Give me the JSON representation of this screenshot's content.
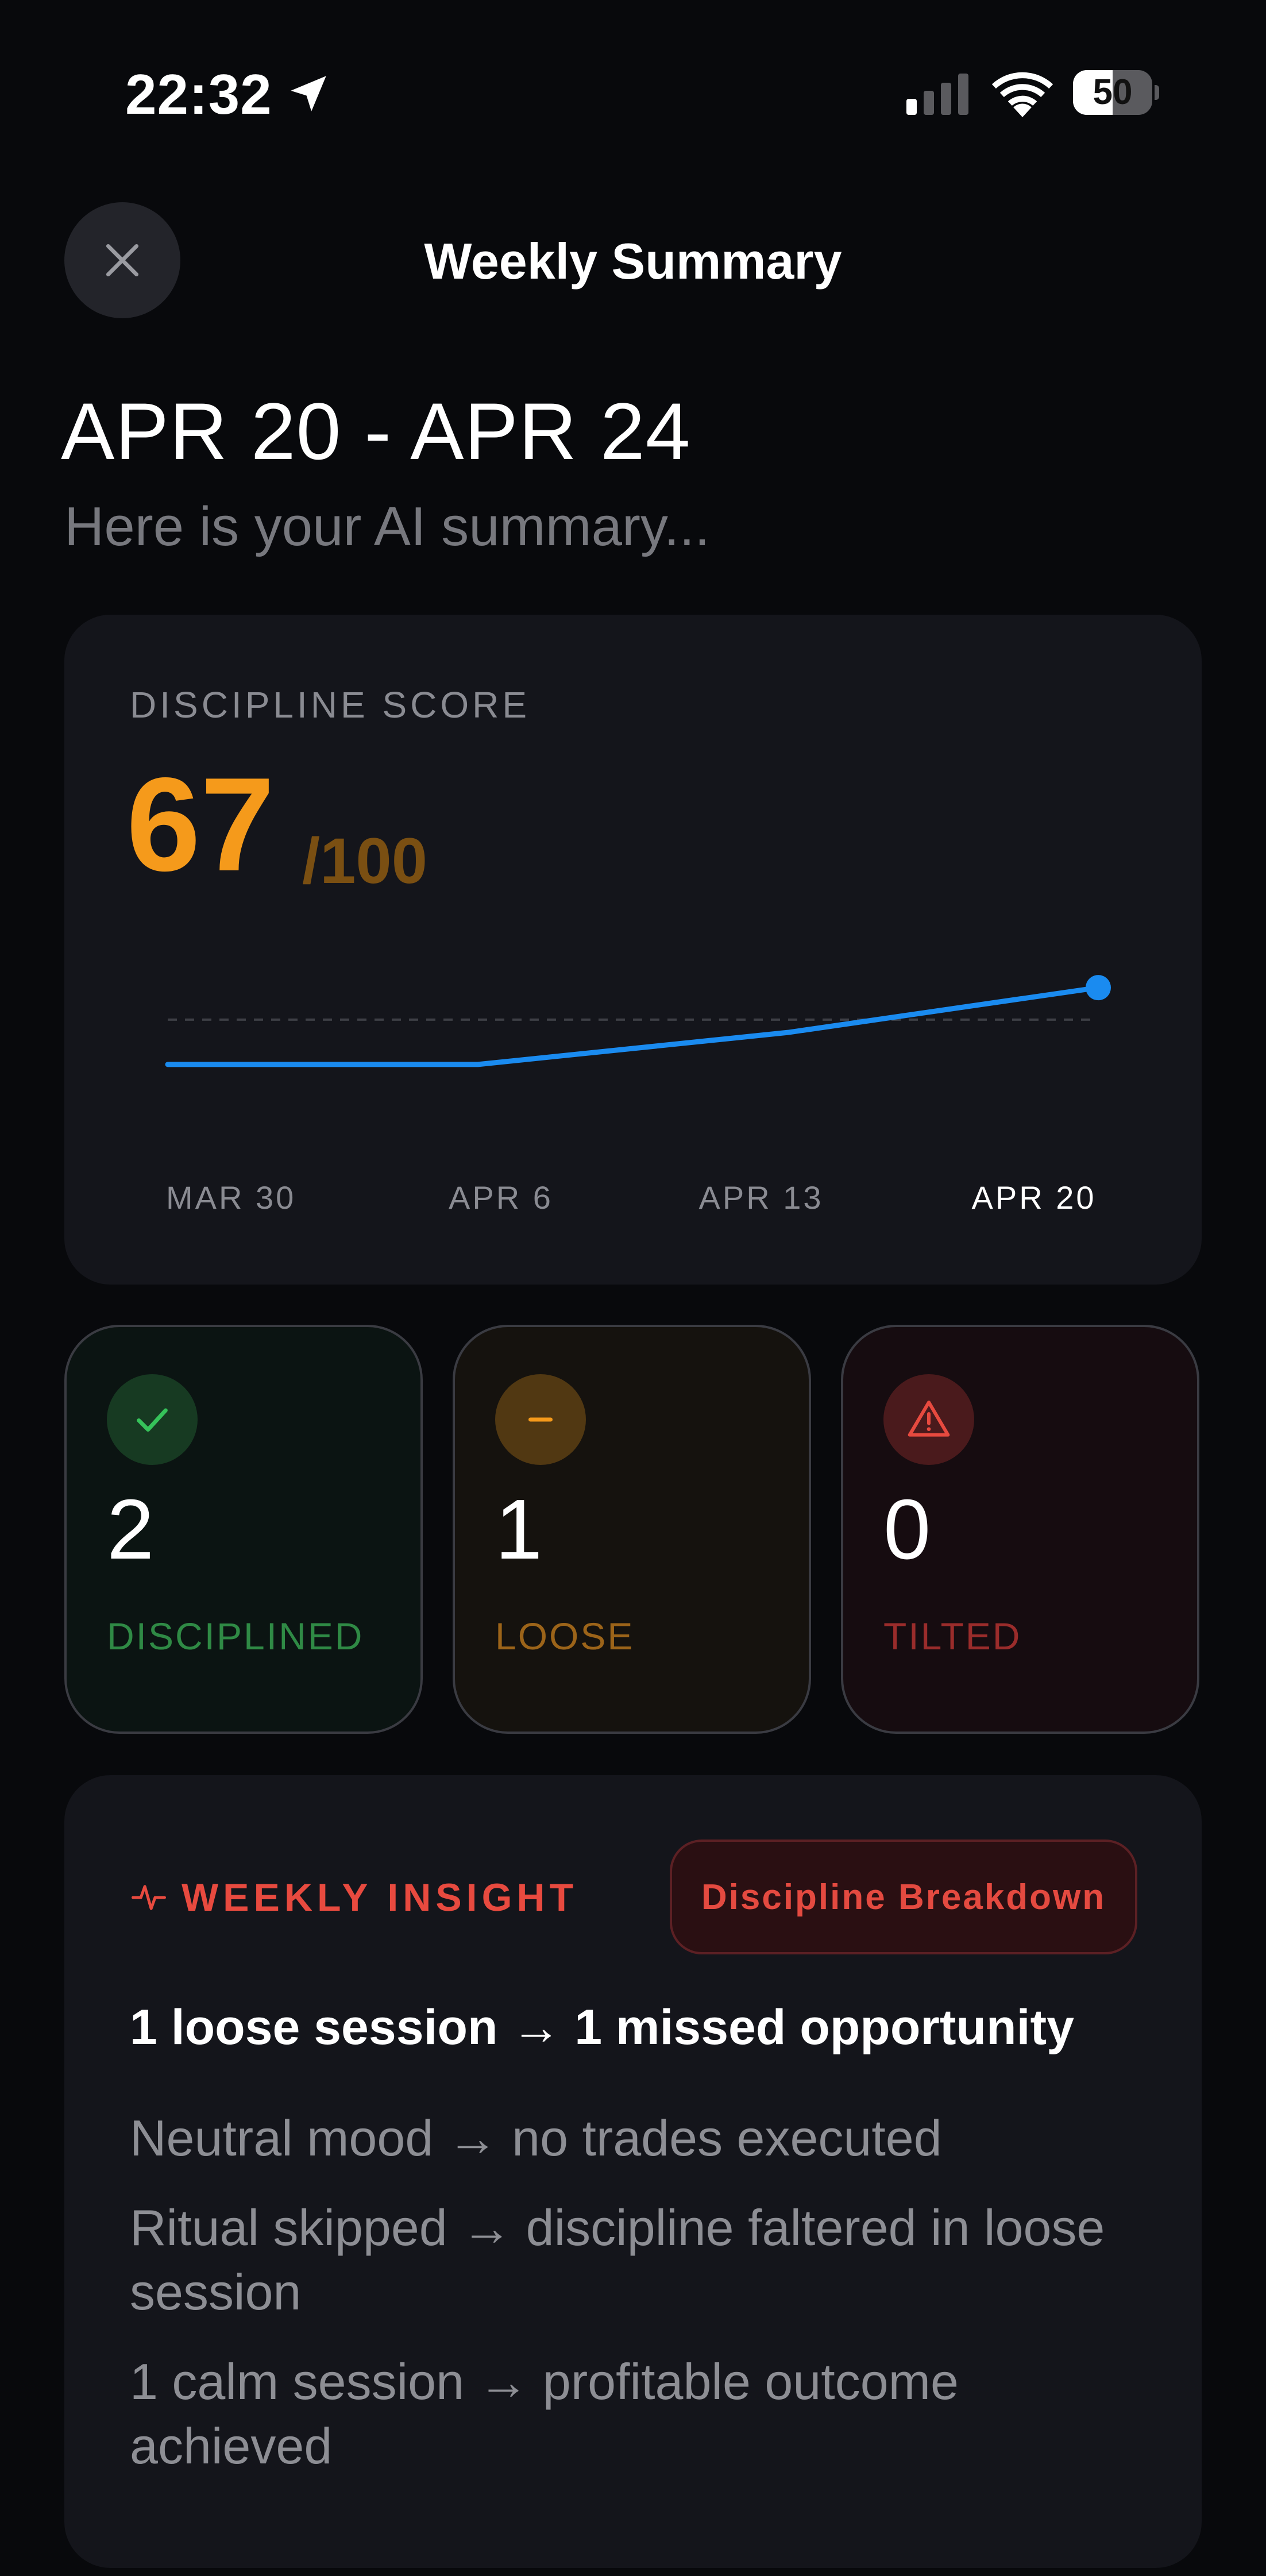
{
  "status_bar": {
    "time": "22:32",
    "battery_level": "50",
    "battery_fraction": 0.5,
    "icons": [
      "location-arrow-icon",
      "signal-icon",
      "wifi-icon",
      "battery-icon"
    ]
  },
  "header": {
    "title": "Weekly Summary",
    "close_icon": "close-icon"
  },
  "summary": {
    "date_range": "APR 20 - APR 24",
    "subtitle": "Here is your AI summary..."
  },
  "discipline": {
    "label": "DISCIPLINE SCORE",
    "score": "67",
    "max": "/100",
    "score_color": "#f59a1b"
  },
  "chart_data": {
    "type": "line",
    "categories": [
      "MAR 30",
      "APR 6",
      "APR 13",
      "APR 20"
    ],
    "series": [
      {
        "values": [
          55,
          55,
          60,
          67
        ]
      }
    ],
    "reference_line": 62,
    "active_category": "APR 20",
    "ylim": [
      40,
      75
    ],
    "line_color": "#1a8bf0",
    "grid": false
  },
  "stats": [
    {
      "count": "2",
      "label": "DISCIPLINED",
      "icon": "check-icon",
      "color": "#2f8a45"
    },
    {
      "count": "1",
      "label": "LOOSE",
      "icon": "minus-icon",
      "color": "#9c6419"
    },
    {
      "count": "0",
      "label": "TILTED",
      "icon": "warning-icon",
      "color": "#9a2c2b"
    }
  ],
  "insight": {
    "heading": "WEEKLY INSIGHT",
    "heading_icon": "pulse-icon",
    "button_label": "Discipline Breakdown",
    "headline": "1 loose session → 1 missed opportunity",
    "items": [
      "Neutral mood → no trades executed",
      "Ritual skipped → discipline faltered in loose session",
      "1 calm session → profitable outcome achieved"
    ],
    "accent_color": "#e84a3f"
  }
}
